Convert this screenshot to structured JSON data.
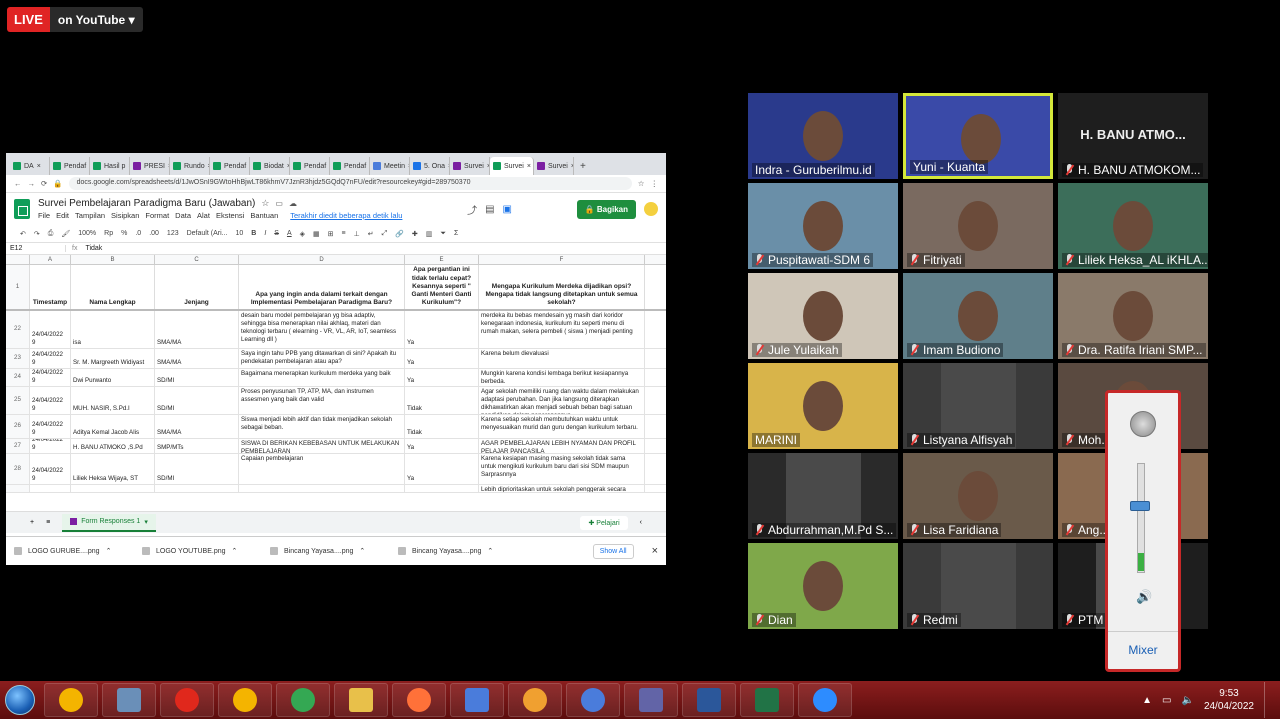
{
  "stream": {
    "live_label": "LIVE",
    "platform_label": "on YouTube",
    "dropdown_icon": "chevron-down-icon"
  },
  "browser": {
    "tabs": [
      "DA",
      "Pendaf",
      "Hasil p",
      "PRESI",
      "Rundo",
      "Pendaf",
      "Biodat",
      "Pendaf",
      "Pendaf",
      "Meetin",
      "5. Ona",
      "Survei",
      "Survei",
      "Survei"
    ],
    "tab_colors": [
      "#0f9d58",
      "#0f9d58",
      "#0f9d58",
      "#7b1fa2",
      "#0f9d58",
      "#0f9d58",
      "#0f9d58",
      "#0f9d58",
      "#0f9d58",
      "#4a7cdb",
      "#1a73e8",
      "#7b1fa2",
      "#0f9d58",
      "#7b1fa2"
    ],
    "active_tab_index": 12,
    "url": "docs.google.com/spreadsheets/d/1JwOSnI9GWtoHhBjwLT86khmV7JznR3hjdz5GQdQ7nFU/edit?resourcekey#gid=289750370"
  },
  "sheet": {
    "title": "Survei Pembelajaran Paradigma Baru (Jawaban)",
    "menus": [
      "File",
      "Edit",
      "Tampilan",
      "Sisipkan",
      "Format",
      "Data",
      "Alat",
      "Ekstensi",
      "Bantuan"
    ],
    "last_edit": "Terakhir diedit beberapa detik lalu",
    "share_label": "Bagikan",
    "toolbar": {
      "zoom": "100%",
      "currency": "Rp",
      "percent": "%",
      "dec_less": ".0",
      "dec_more": ".00",
      "format_123": "123",
      "font": "Default (Ari...",
      "font_size": "10",
      "bold": "B",
      "italic": "I",
      "strike": "S",
      "text_color": "A",
      "sum": "Σ"
    },
    "cell_ref": "E12",
    "formula_value": "Tidak",
    "columns": [
      "",
      "A",
      "B",
      "C",
      "D",
      "E",
      "F"
    ],
    "headers": {
      "rownum": "1",
      "a": "Timestamp",
      "b": "Nama Lengkap",
      "c": "Jenjang",
      "d": "Apa yang ingin anda dalami terkait dengan Implementasi Pembelajaran Paradigma Baru?",
      "e": "Apa pergantian ini tidak terlalu cepat? Kesannya seperti \" Ganti Menteri Ganti Kurikulum\"?",
      "f": "Mengapa Kurikulum Merdeka dijadikan opsi? Mengapa tidak langsung ditetapkan untuk semua sekolah?"
    },
    "rows": [
      {
        "n": "22",
        "a": "24/04/2022 9",
        "b": "isa",
        "c": "SMA/MA",
        "d": "desain baru model pembelajaran yg bisa adaptiv, sehingga bisa menerapkan nilai akhlaq, materi dan teknologi terbaru ( elearning - VR, VL, AR, IoT, seamless Learning dll )",
        "e": "Ya",
        "f": "merdeka itu bebas mendesain yg masih dari koridor kenegaraan indonesia, kurikulum itu seperti menu di rumah makan, selera pembeli ( siswa ) menjadi penting"
      },
      {
        "n": "23",
        "a": "24/04/2022 9",
        "b": "Sr. M. Margreeth Widiyast",
        "c": "SMA/MA",
        "d": "Saya ingin tahu PPB yang ditawarkan di sini? Apakah itu pendekatan pembelajaran atau apa?",
        "e": "Ya",
        "f": "Karena belum dievaluasi"
      },
      {
        "n": "24",
        "a": "24/04/2022 9",
        "b": "Dwi Purwanto",
        "c": "SD/MI",
        "d": "Bagaimana menerapkan kurikulum merdeka yang baik",
        "e": "Ya",
        "f": "Mungkin karena kondisi lembaga berikut kesiapannya berbeda."
      },
      {
        "n": "25",
        "a": "24/04/2022 9",
        "b": "MUH. NASIR, S.Pd.I",
        "c": "SD/MI",
        "d": "Proses penyusunan TP, ATP, MA, dan instrumen assesmen yang baik dan valid",
        "e": "Tidak",
        "f": "Agar sekolah memiliki ruang dan waktu dalam melakukan adaptasi perubahan. Dan jika langsung diterapkan dikhawatirkan akan menjadi sebuah beban bagi satuan pendidikan dalam penerapannya."
      },
      {
        "n": "26",
        "a": "24/04/2022 9",
        "b": "Aditya Kemal Jacob Alis",
        "c": "SMA/MA",
        "d": "Siswa menjadi lebih aktif dan tidak menjadikan sekolah sebagai beban.",
        "e": "Tidak",
        "f": "Karena setiap sekolah membutuhkan waktu untuk menyesuaikan murid dan guru dengan kurikulum terbaru."
      },
      {
        "n": "27",
        "a": "24/04/2022 9",
        "b": "H. BANU ATMOKO ,S.Pd",
        "c": "SMP/MTs",
        "d": "SISWA DI BERIKAN KEBEBASAN UNTUK MELAKUKAN PEMBELAJARAN",
        "e": "Ya",
        "f": "AGAR PEMBELAJARAN LEBIH NYAMAN DAN PROFIL PELAJAR PANCASILA"
      },
      {
        "n": "28",
        "a": "24/04/2022 9",
        "b": "Liliek Heksa Wijaya, ST",
        "c": "SD/MI",
        "d": "Capaian pembelajaran",
        "e": "Ya",
        "f": "Karena kesiapan masing masing sekolah tidak sama untuk mengikuti kurikulum baru dari sisi SDM maupun Sarprasnnya"
      }
    ],
    "row_last_f": "Lebih diprioritaskan untuk sekolah penggerak secara",
    "sheet_tab": "Form Responses 1",
    "explore_label": "Pelajari"
  },
  "downloads": {
    "files": [
      "LOGO GURUBE....png",
      "LOGO YOUTUBE.png",
      "Bincang Yayasa....png",
      "Bincang Yayasa....png"
    ],
    "show_all": "Show All"
  },
  "zoom": {
    "participants": [
      {
        "name": "Indra - Guruberilmu.id",
        "muted": false,
        "bg": "#2a3a8c"
      },
      {
        "name": "Yuni - Kuanta",
        "muted": false,
        "bg": "#3a4aa8",
        "active": true
      },
      {
        "name": "H. BANU ATMOKOM...",
        "muted": true,
        "bg": "#1e1e1e",
        "big": "H. BANU ATMO..."
      },
      {
        "name": "Puspitawati-SDM 6",
        "muted": true,
        "bg": "#6a8fa8"
      },
      {
        "name": "Fitriyati",
        "muted": true,
        "bg": "#7a6a60"
      },
      {
        "name": "Liliek Heksa_AL iKHLA...",
        "muted": true,
        "bg": "#3c6e5a"
      },
      {
        "name": "Jule Yulaikah",
        "muted": true,
        "bg": "#cfc6b8"
      },
      {
        "name": "Imam Budiono",
        "muted": true,
        "bg": "#5f7f8a"
      },
      {
        "name": "Dra. Ratifa Iriani SMP...",
        "muted": true,
        "bg": "#8a7a6a"
      },
      {
        "name": "MARINI",
        "muted": false,
        "bg": "#d8b44a"
      },
      {
        "name": "Listyana Alfisyah",
        "muted": true,
        "bg": "#3a3a3a"
      },
      {
        "name": "Moh...nid...",
        "muted": true,
        "bg": "#5a4a40"
      },
      {
        "name": "Abdurrahman,M.Pd S...",
        "muted": true,
        "bg": "#2a2a2a"
      },
      {
        "name": "Lisa Faridiana",
        "muted": true,
        "bg": "#6a5a4a"
      },
      {
        "name": "Ang...dh...",
        "muted": true,
        "bg": "#8a6a50"
      },
      {
        "name": "Dian",
        "muted": true,
        "bg": "#7fa84a"
      },
      {
        "name": "Redmi",
        "muted": true,
        "bg": "#3a3a3a"
      },
      {
        "name": "PTM",
        "muted": true,
        "bg": "#1e1e1e"
      }
    ]
  },
  "volume": {
    "mixer_label": "Mixer",
    "level": 0.55
  },
  "taskbar": {
    "apps": [
      "chrome-guest-icon",
      "computer-icon",
      "opera-icon",
      "chrome-alt-icon",
      "chrome-icon",
      "file-explorer-icon",
      "firefox-icon",
      "remote-desktop-icon",
      "media-player-icon",
      "chrome-blue-icon",
      "teams-icon",
      "word-icon",
      "excel-icon",
      "zoom-icon"
    ],
    "app_colors": [
      "#f4b400",
      "#6a8fb8",
      "#e0281c",
      "#f4b400",
      "#34a853",
      "#e8c04a",
      "#ff7139",
      "#4a7cdb",
      "#f0a030",
      "#4a7cdb",
      "#6264a7",
      "#2b579a",
      "#217346",
      "#2d8cff"
    ],
    "time": "9:53",
    "date": "24/04/2022"
  }
}
